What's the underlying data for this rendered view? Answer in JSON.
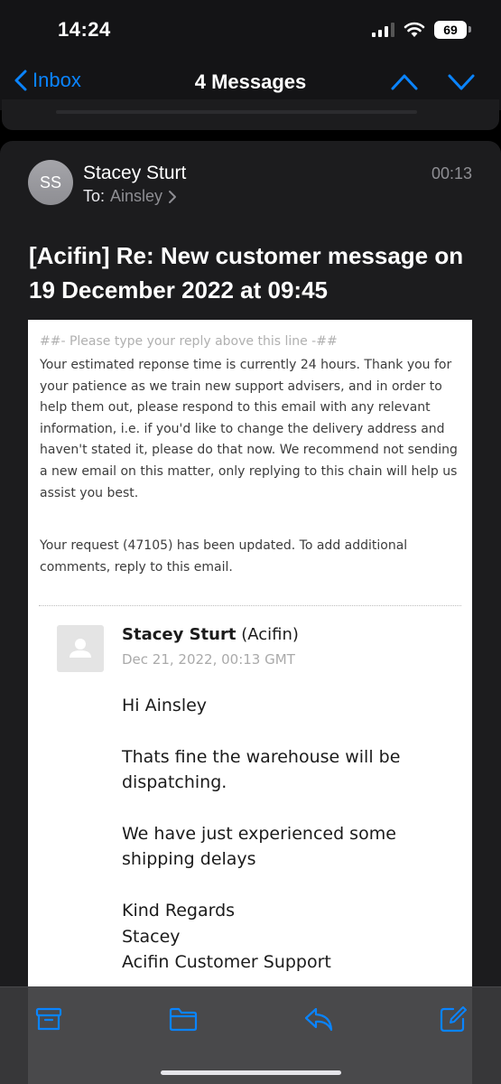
{
  "status": {
    "time": "14:24",
    "battery": "69"
  },
  "nav": {
    "back_label": "Inbox",
    "title": "4 Messages"
  },
  "email": {
    "avatar_initials": "SS",
    "sender": "Stacey Sturt",
    "to_label": "To:",
    "recipient": "Ainsley",
    "time": "00:13",
    "subject": "[Acifin] Re: New customer message on 19 December 2022 at 09:45",
    "reply_line": "##- Please type your reply above this line -##",
    "auto_message": "Your estimated reponse time is currently 24 hours. Thank you for your patience as we train new support advisers, and in order to help them out, please respond to this email with any relevant information, i.e. if you'd like to change the delivery address and haven't stated it, please do that now. We recommend not sending a new email on this matter, only replying to this chain will help us assist you best.",
    "request_message": "Your request (47105) has been updated. To add additional comments, reply to this email.",
    "message": {
      "author": "Stacey Sturt",
      "org": "(Acifin)",
      "date": "Dec 21, 2022, 00:13 GMT",
      "greeting": "Hi Ainsley",
      "para1": "Thats fine the warehouse will be dispatching.",
      "para2": "We have just experienced some shipping delays",
      "signoff_line1": "Kind Regards",
      "signoff_line2": "Stacey",
      "signoff_line3": "Acifin Customer Support"
    }
  },
  "icons": {
    "back": "chevron-left-icon",
    "up": "chevron-up-icon",
    "down": "chevron-down-icon",
    "archive": "archive-icon",
    "folder": "folder-icon",
    "reply": "reply-icon",
    "compose": "compose-icon"
  },
  "colors": {
    "accent": "#0a84ff",
    "background": "#000000",
    "card": "#1c1c1e"
  }
}
